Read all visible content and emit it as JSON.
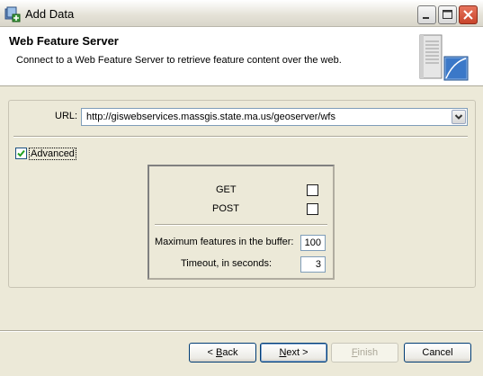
{
  "window": {
    "title": "Add Data",
    "title_icon": "add-data-icon",
    "controls": [
      "minimize-icon",
      "maximize-icon",
      "close-icon"
    ]
  },
  "header": {
    "title": "Web Feature Server",
    "description": "Connect to a Web Feature Server to retrieve feature content over the web.",
    "graphic": "server-icon"
  },
  "connection": {
    "url_label": "URL:",
    "url_value": "http://giswebservices.massgis.state.ma.us/geoserver/wfs"
  },
  "advanced": {
    "label": "Advanced",
    "checked": true,
    "get_label": "GET",
    "get_checked": false,
    "post_label": "POST",
    "post_checked": false,
    "max_features_label": "Maximum features in the buffer:",
    "max_features_value": "100",
    "timeout_label": "Timeout, in seconds:",
    "timeout_value": "3"
  },
  "buttons": {
    "back_prefix": "< ",
    "back_key": "B",
    "back_rest": "ack",
    "next_key": "N",
    "next_rest": "ext >",
    "finish_key": "F",
    "finish_rest": "inish",
    "cancel": "Cancel"
  },
  "colors": {
    "accent_border": "#003c74",
    "dialog_bg": "#ece9d8",
    "close_button": "#c8442b"
  }
}
